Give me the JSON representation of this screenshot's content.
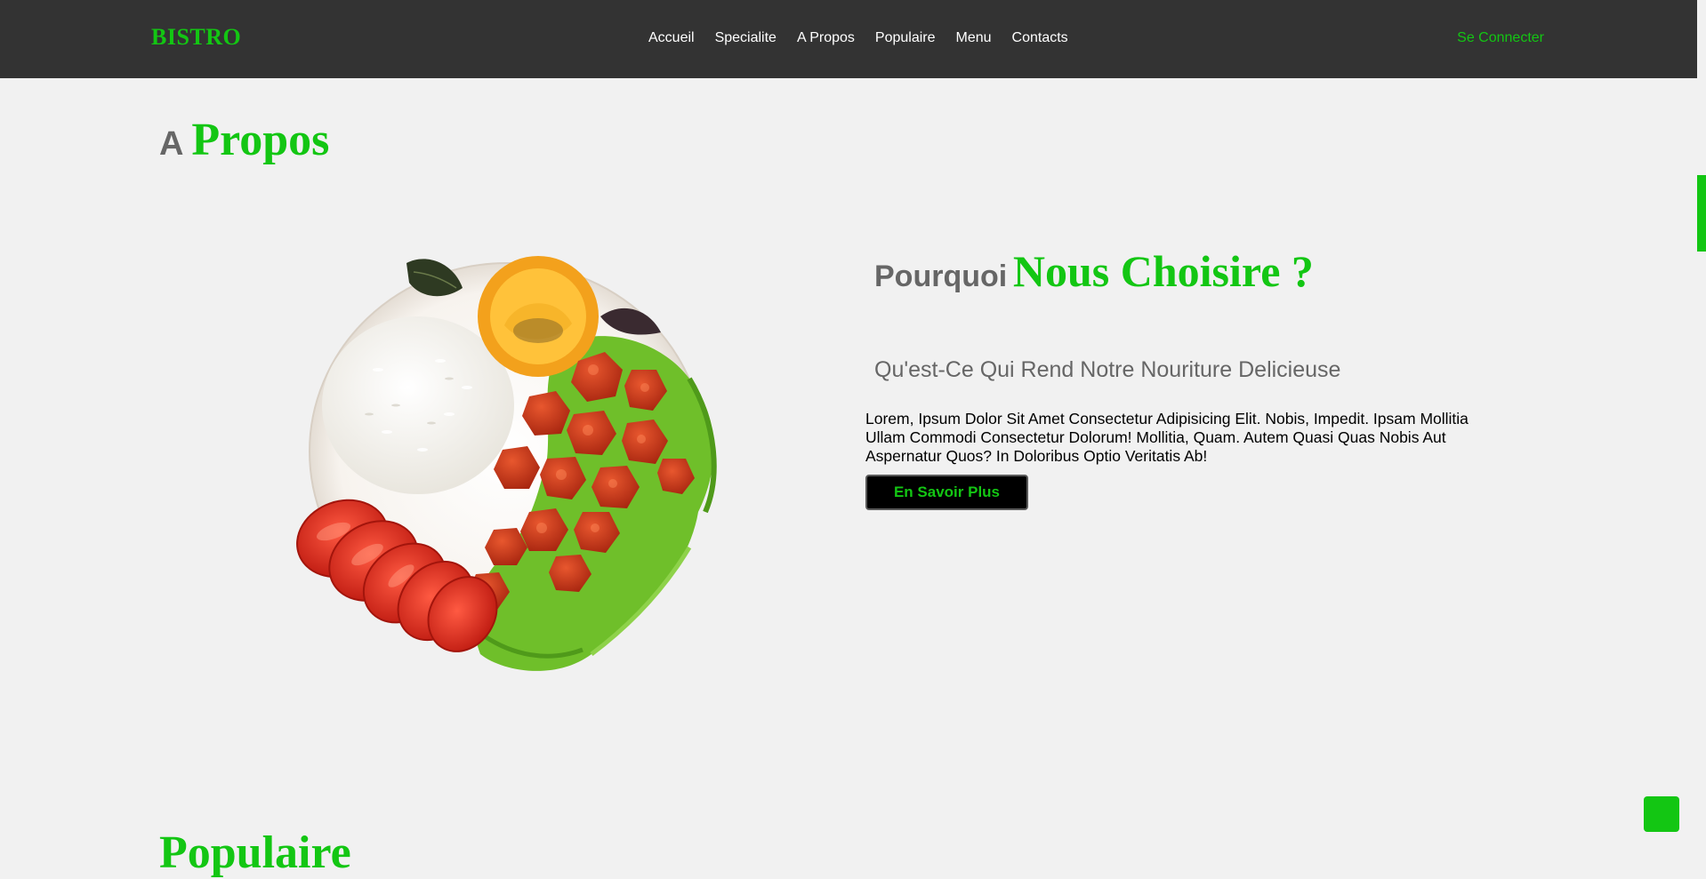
{
  "navbar": {
    "brand": "BISTRO",
    "links": [
      "Accueil",
      "Specialite",
      "A Propos",
      "Populaire",
      "Menu",
      "Contacts"
    ],
    "login_label": "Se Connecter"
  },
  "about": {
    "title_prefix": "A",
    "title_main": "Propos",
    "image_alt": "plat-poulet-riz-salade-tomates",
    "why_prefix": "Pourquoi",
    "why_main": "Nous Choisire ?",
    "subtitle": "Qu'est-Ce Qui Rend Notre Nouriture Delicieuse",
    "description": "Lorem, Ipsum Dolor Sit Amet Consectetur Adipisicing Elit. Nobis, Impedit. Ipsam Mollitia Ullam Commodi Consectetur Dolorum! Mollitia, Quam. Autem Quasi Quas Nobis Aut Aspernatur Quos? In Doloribus Optio Veritatis Ab!",
    "button_label": "En Savoir Plus"
  },
  "next_section": {
    "title": "Populaire"
  },
  "colors": {
    "accent": "#13c613",
    "navbar_bg": "#333333",
    "page_bg": "#f1f1f1",
    "muted_text": "#666666"
  },
  "icons": {
    "scroll_top": "scroll-to-top-icon"
  }
}
